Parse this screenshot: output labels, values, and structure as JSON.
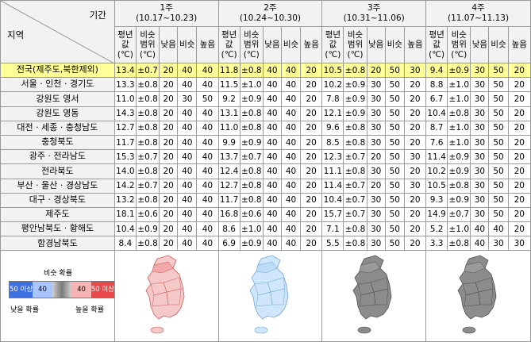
{
  "header": {
    "period_label": "기간",
    "region_label": "지역",
    "weeks": [
      {
        "name": "1주",
        "range": "(10.17~10.23)"
      },
      {
        "name": "2주",
        "range": "(10.24~10.30)"
      },
      {
        "name": "3주",
        "range": "(10.31~11.06)"
      },
      {
        "name": "4주",
        "range": "(11.07~11.13)"
      }
    ],
    "cols": [
      "평년값 (℃)",
      "비슷 범위 (℃)",
      "낮음",
      "비슷",
      "높음"
    ]
  },
  "rows": [
    {
      "region": "전국(제주도,북한제외)",
      "w": [
        [
          "13.4",
          "±0.7",
          "20",
          "40",
          "40"
        ],
        [
          "11.8",
          "±0.8",
          "40",
          "40",
          "20"
        ],
        [
          "10.5",
          "±0.8",
          "20",
          "50",
          "30"
        ],
        [
          "9.4",
          "±0.9",
          "30",
          "50",
          "20"
        ]
      ]
    },
    {
      "region": "서울 · 인천 · 경기도",
      "w": [
        [
          "13.3",
          "±0.8",
          "20",
          "40",
          "40"
        ],
        [
          "11.5",
          "±1.0",
          "40",
          "40",
          "20"
        ],
        [
          "10.2",
          "±0.9",
          "30",
          "50",
          "20"
        ],
        [
          "8.8",
          "±1.0",
          "30",
          "50",
          "20"
        ]
      ]
    },
    {
      "region": "강원도 영서",
      "w": [
        [
          "11.0",
          "±0.8",
          "20",
          "30",
          "50"
        ],
        [
          "9.2",
          "±0.9",
          "40",
          "40",
          "20"
        ],
        [
          "7.8",
          "±0.9",
          "30",
          "50",
          "20"
        ],
        [
          "6.7",
          "±1.0",
          "30",
          "50",
          "20"
        ]
      ]
    },
    {
      "region": "강원도 영동",
      "w": [
        [
          "14.3",
          "±0.8",
          "20",
          "40",
          "40"
        ],
        [
          "13.1",
          "±0.8",
          "40",
          "40",
          "20"
        ],
        [
          "12.1",
          "±0.9",
          "30",
          "50",
          "20"
        ],
        [
          "10.4",
          "±0.8",
          "30",
          "50",
          "20"
        ]
      ]
    },
    {
      "region": "대전 · 세종 · 충청남도",
      "w": [
        [
          "12.7",
          "±0.8",
          "20",
          "40",
          "40"
        ],
        [
          "11.0",
          "±0.8",
          "40",
          "40",
          "20"
        ],
        [
          "9.6",
          "±0.8",
          "30",
          "50",
          "20"
        ],
        [
          "8.7",
          "±1.0",
          "30",
          "50",
          "20"
        ]
      ]
    },
    {
      "region": "충청북도",
      "w": [
        [
          "11.7",
          "±0.8",
          "20",
          "40",
          "40"
        ],
        [
          "9.9",
          "±0.9",
          "40",
          "40",
          "20"
        ],
        [
          "8.5",
          "±0.8",
          "30",
          "50",
          "20"
        ],
        [
          "7.6",
          "±1.0",
          "30",
          "50",
          "20"
        ]
      ]
    },
    {
      "region": "광주 · 전라남도",
      "w": [
        [
          "15.3",
          "±0.7",
          "20",
          "40",
          "40"
        ],
        [
          "13.7",
          "±0.7",
          "40",
          "40",
          "20"
        ],
        [
          "12.3",
          "±0.7",
          "20",
          "50",
          "30"
        ],
        [
          "11.4",
          "±0.9",
          "30",
          "50",
          "20"
        ]
      ]
    },
    {
      "region": "전라북도",
      "w": [
        [
          "14.0",
          "±0.8",
          "20",
          "40",
          "40"
        ],
        [
          "12.4",
          "±0.8",
          "40",
          "40",
          "20"
        ],
        [
          "11.1",
          "±0.8",
          "30",
          "50",
          "20"
        ],
        [
          "10.2",
          "±0.9",
          "30",
          "50",
          "20"
        ]
      ]
    },
    {
      "region": "부산 · 울산 · 경상남도",
      "w": [
        [
          "14.2",
          "±0.7",
          "20",
          "40",
          "40"
        ],
        [
          "12.7",
          "±0.8",
          "40",
          "40",
          "20"
        ],
        [
          "11.4",
          "±0.7",
          "20",
          "50",
          "30"
        ],
        [
          "10.5",
          "±0.8",
          "30",
          "50",
          "20"
        ]
      ]
    },
    {
      "region": "대구 · 경상북도",
      "w": [
        [
          "13.2",
          "±0.8",
          "20",
          "40",
          "40"
        ],
        [
          "11.7",
          "±0.8",
          "40",
          "40",
          "20"
        ],
        [
          "10.4",
          "±0.7",
          "30",
          "50",
          "20"
        ],
        [
          "9.3",
          "±0.9",
          "30",
          "50",
          "20"
        ]
      ]
    },
    {
      "region": "제주도",
      "w": [
        [
          "18.1",
          "±0.6",
          "20",
          "40",
          "40"
        ],
        [
          "16.8",
          "±0.6",
          "40",
          "40",
          "20"
        ],
        [
          "15.7",
          "±0.7",
          "30",
          "50",
          "20"
        ],
        [
          "14.9",
          "±0.7",
          "30",
          "50",
          "20"
        ]
      ]
    },
    {
      "region": "평안남북도 · 황해도",
      "w": [
        [
          "10.4",
          "±0.9",
          "20",
          "40",
          "40"
        ],
        [
          "8.6",
          "±1.0",
          "40",
          "40",
          "20"
        ],
        [
          "7.1",
          "±0.8",
          "30",
          "50",
          "20"
        ],
        [
          "5.2",
          "±1.0",
          "40",
          "40",
          "20"
        ]
      ]
    },
    {
      "region": "함경남북도",
      "w": [
        [
          "8.4",
          "±0.8",
          "20",
          "40",
          "40"
        ],
        [
          "6.9",
          "±0.9",
          "40",
          "40",
          "20"
        ],
        [
          "5.5",
          "±0.8",
          "30",
          "50",
          "20"
        ],
        [
          "3.3",
          "±0.8",
          "40",
          "30",
          "30"
        ]
      ]
    }
  ],
  "legend": {
    "similar_prob": "비슷 확률",
    "low_prob": "낮을 확률",
    "high_prob": "높을 확률",
    "bar_labels": [
      "50 이상",
      "40",
      "",
      "40",
      "50 이상"
    ],
    "colors": {
      "low_strong": "#3d6fe0",
      "low_weak": "#a9c5ff",
      "mid": "#7a7a7a",
      "high_weak": "#f7b4b4",
      "high_strong": "#e84a4a"
    }
  },
  "maps": [
    {
      "week": "1주",
      "fill": "#f6c9c9",
      "accent": "#f0a8a8",
      "stroke": "#c85b5b"
    },
    {
      "week": "2주",
      "fill": "#cfe6fb",
      "accent": "#bcdcf6",
      "stroke": "#6fa4d8"
    },
    {
      "week": "3주",
      "fill": "#8c8c8c",
      "accent": "#9a9a9a",
      "stroke": "#4d4d4d"
    },
    {
      "week": "4주",
      "fill": "#8c8c8c",
      "accent": "#9a9a9a",
      "stroke": "#4d4d4d"
    }
  ]
}
